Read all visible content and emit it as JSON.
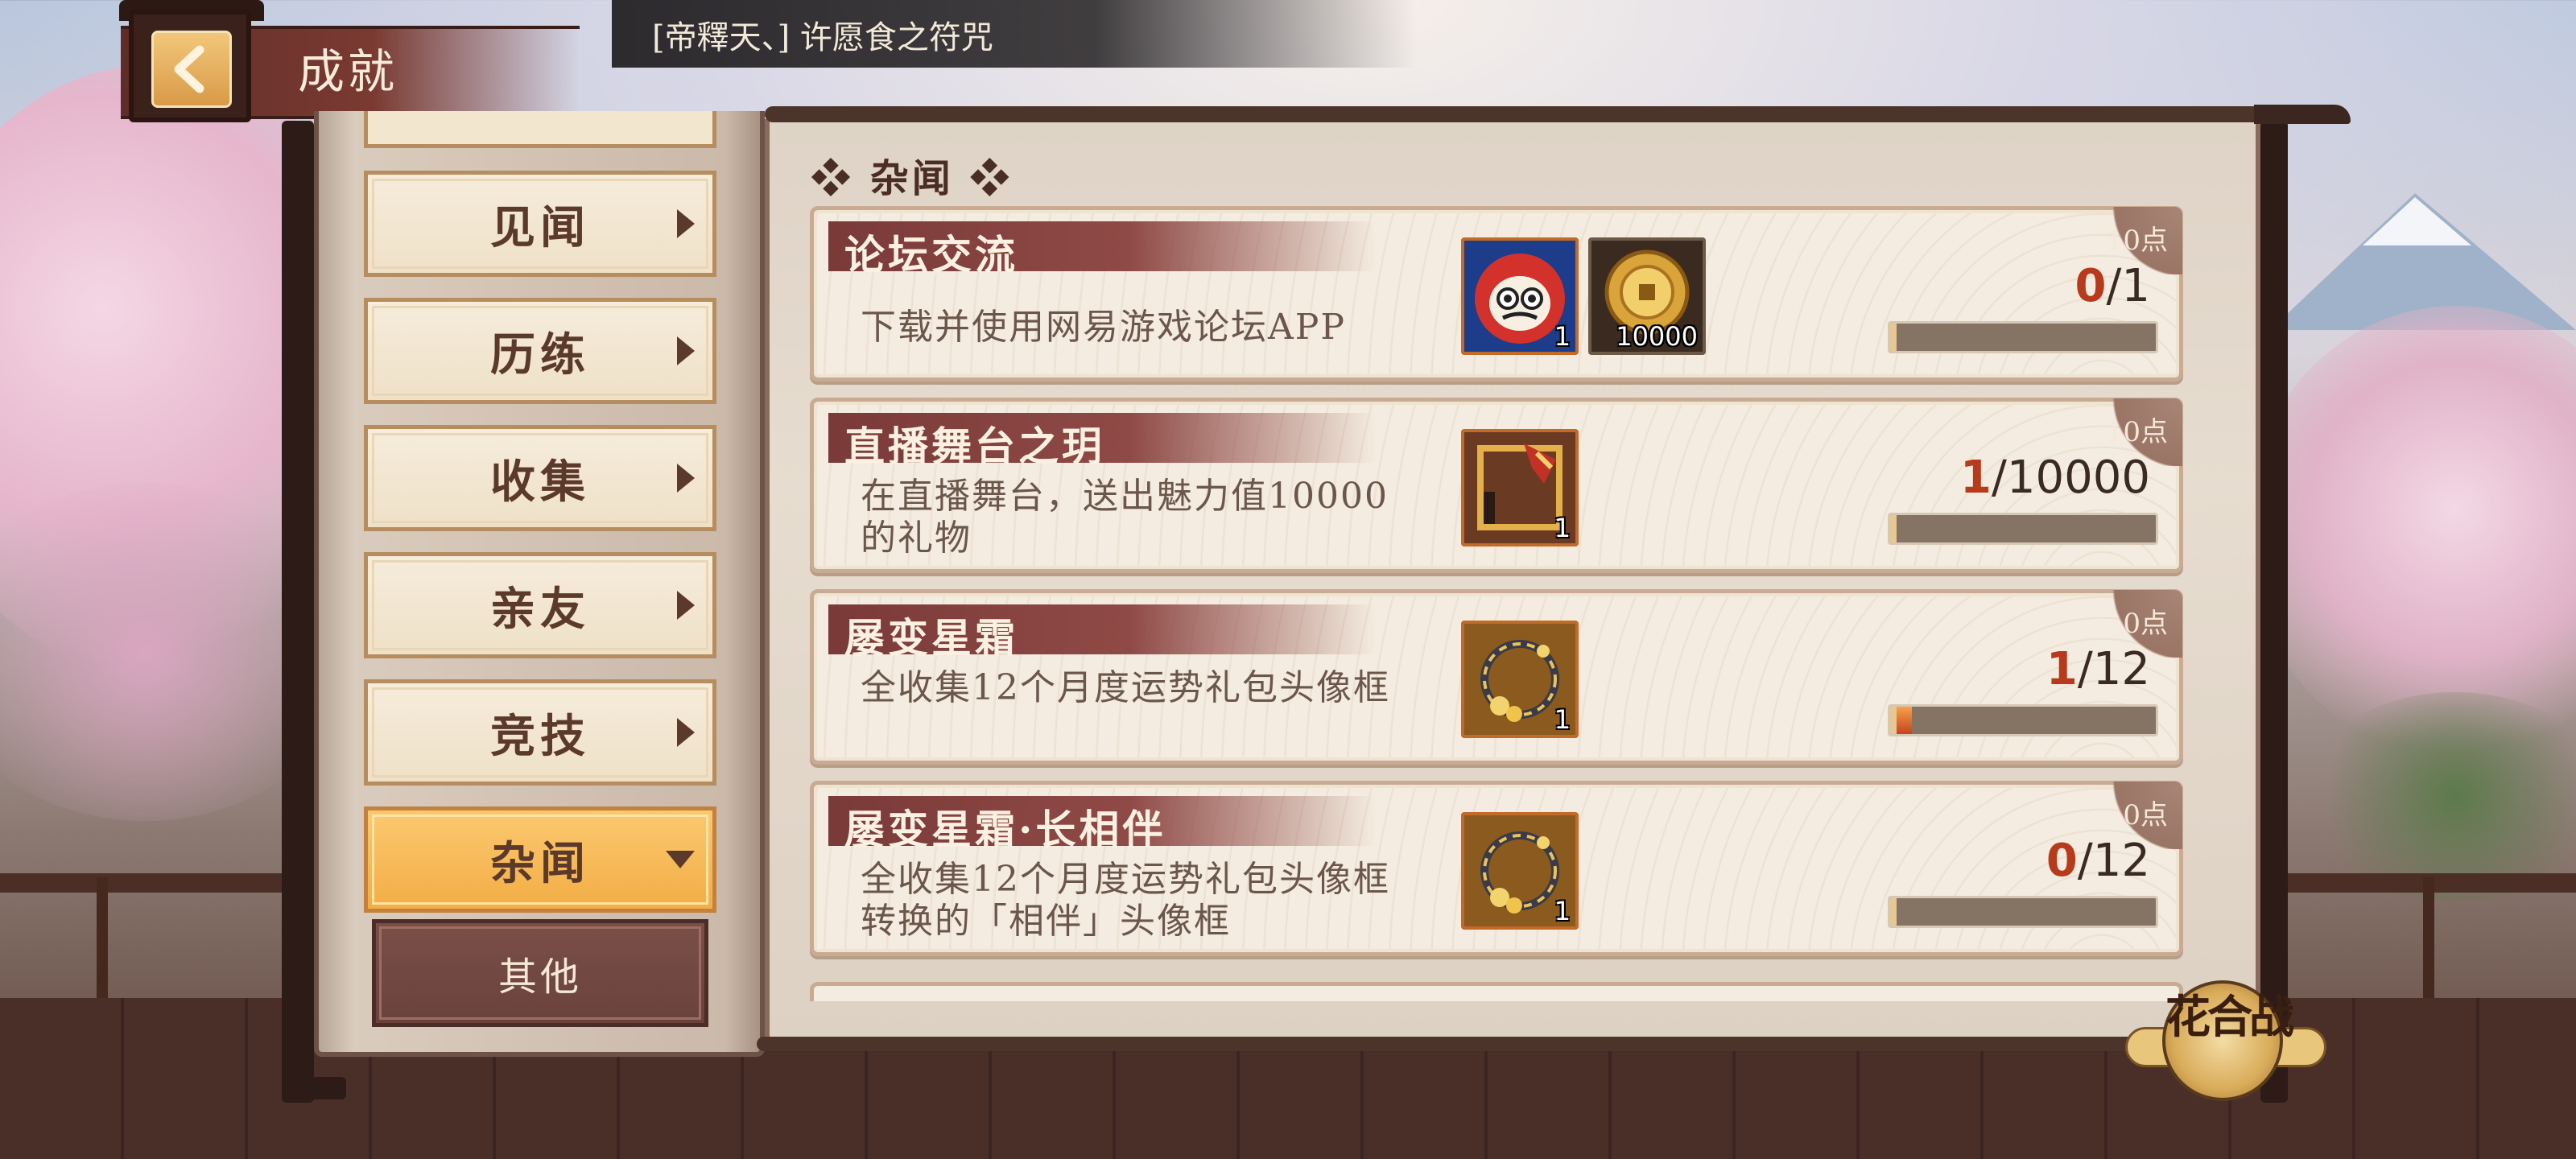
{
  "header": {
    "player_name": "[帝釋天、] 许愿食之符咒",
    "title": "成就"
  },
  "sidebar": {
    "tabs": [
      {
        "label": "见闻",
        "active": false
      },
      {
        "label": "历练",
        "active": false
      },
      {
        "label": "收集",
        "active": false
      },
      {
        "label": "亲友",
        "active": false
      },
      {
        "label": "竞技",
        "active": false
      },
      {
        "label": "杂闻",
        "active": true
      }
    ],
    "subtabs": [
      {
        "label": "其他"
      }
    ]
  },
  "main": {
    "section_title": "❖ 杂闻 ❖",
    "achievements": [
      {
        "name": "论坛交流",
        "description": "下载并使用网易游戏论坛APP",
        "points": "10点",
        "progress_current": "0",
        "progress_total": "/1",
        "progress_fraction": 0,
        "rewards": [
          {
            "icon": "daruma-icon",
            "count": "1"
          },
          {
            "icon": "gold-coin-icon",
            "count": "10000"
          }
        ]
      },
      {
        "name": "直播舞台之玥",
        "description": "在直播舞台，送出魅力值10000的礼物",
        "points": "10点",
        "progress_current": "1",
        "progress_total": "/10000",
        "progress_fraction": 0.0001,
        "rewards": [
          {
            "icon": "avatar-frame-icon",
            "count": "1"
          }
        ]
      },
      {
        "name": "屡变星霜",
        "description": "全收集12个月度运势礼包头像框",
        "points": "0点",
        "progress_current": "1",
        "progress_total": "/12",
        "progress_fraction": 0.0833,
        "rewards": [
          {
            "icon": "ring-frame-icon",
            "count": "1"
          }
        ]
      },
      {
        "name": "屡变星霜·长相伴",
        "description": "全收集12个月度运势礼包头像框转换的「相伴」头像框",
        "points": "0点",
        "progress_current": "0",
        "progress_total": "/12",
        "progress_fraction": 0,
        "rewards": [
          {
            "icon": "ring-frame-icon",
            "count": "1"
          }
        ]
      }
    ]
  },
  "event_button": {
    "label": "花合战"
  },
  "colors": {
    "accent_red": "#b73a1d",
    "name_bar": "#7a3a38",
    "tab_active": "#f3ad45",
    "tab_idle": "#f6ecdb"
  }
}
